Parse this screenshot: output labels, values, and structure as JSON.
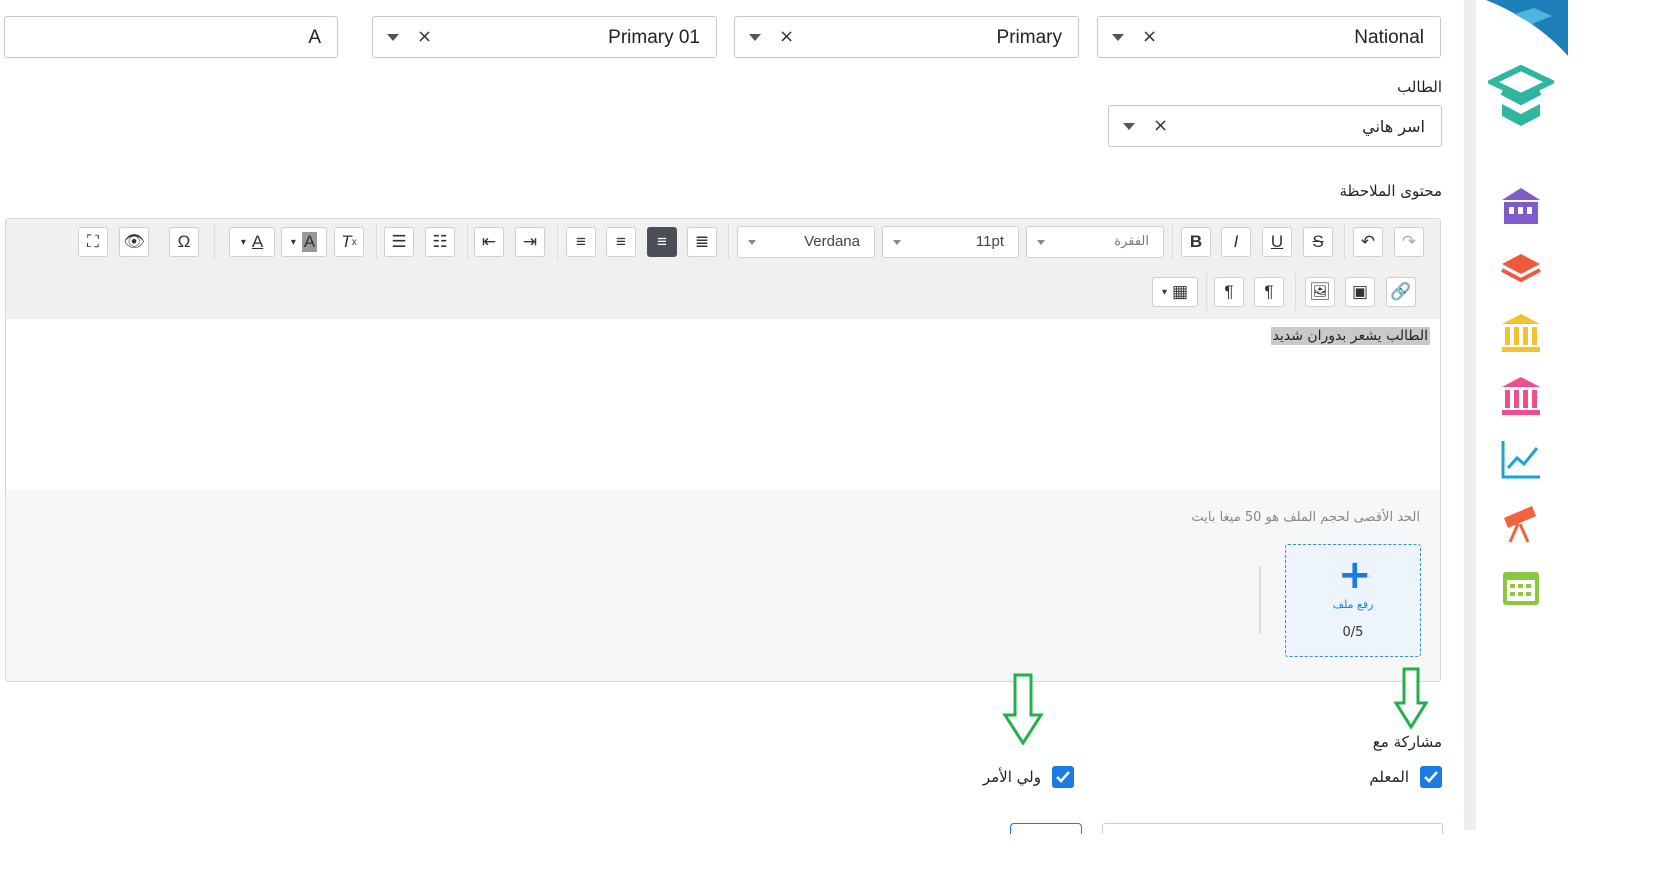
{
  "filters": [
    {
      "name": "national",
      "value": "National"
    },
    {
      "name": "primary",
      "value": "Primary"
    },
    {
      "name": "primary01",
      "value": "Primary 01"
    },
    {
      "name": "text",
      "value": "A"
    }
  ],
  "student": {
    "label": "الطالب",
    "value": "اسر هاني"
  },
  "note": {
    "label": "محتوى الملاحظة",
    "content": "الطالب يشعر بدوران شديد"
  },
  "toolbar": {
    "paragraph": "الفقرة",
    "size": "11pt",
    "font": "Verdana",
    "bold": "B",
    "italic": "I",
    "underline": "U",
    "strike": "S",
    "omega": "Ω"
  },
  "upload": {
    "limit": "الحد الأقصى لحجم الملف هو 50 ميغا بايت",
    "label": "رفع ملف",
    "count": "0/5"
  },
  "share": {
    "label": "مشاركة مع",
    "teacher": "المعلم",
    "parent": "ولي الأمر"
  },
  "colors": {
    "accent": "#1a7be6",
    "arrow": "#21b04b"
  }
}
